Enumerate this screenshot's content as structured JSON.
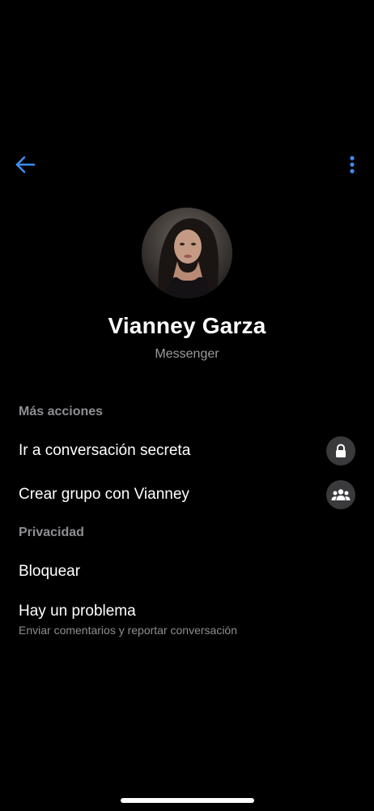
{
  "colors": {
    "background": "#000000",
    "accent": "#3b8ef0",
    "text_primary": "#ffffff",
    "text_secondary": "#8e8e93",
    "icon_bg": "#3a3a3c"
  },
  "header": {
    "back_icon": "arrow-left-icon",
    "menu_icon": "more-vertical-icon"
  },
  "profile": {
    "name": "Vianney Garza",
    "subtitle": "Messenger",
    "avatar_icon": "profile-photo"
  },
  "sections": {
    "more_actions_title": "Más acciones",
    "privacy_title": "Privacidad"
  },
  "actions": {
    "secret_conversation_label": "Ir a conversación secreta",
    "secret_conversation_icon": "lock-icon",
    "create_group_label": "Crear grupo con Vianney",
    "create_group_icon": "group-icon"
  },
  "privacy": {
    "block_label": "Bloquear",
    "problem_label": "Hay un problema",
    "problem_sub": "Enviar comentarios y reportar conversación"
  }
}
